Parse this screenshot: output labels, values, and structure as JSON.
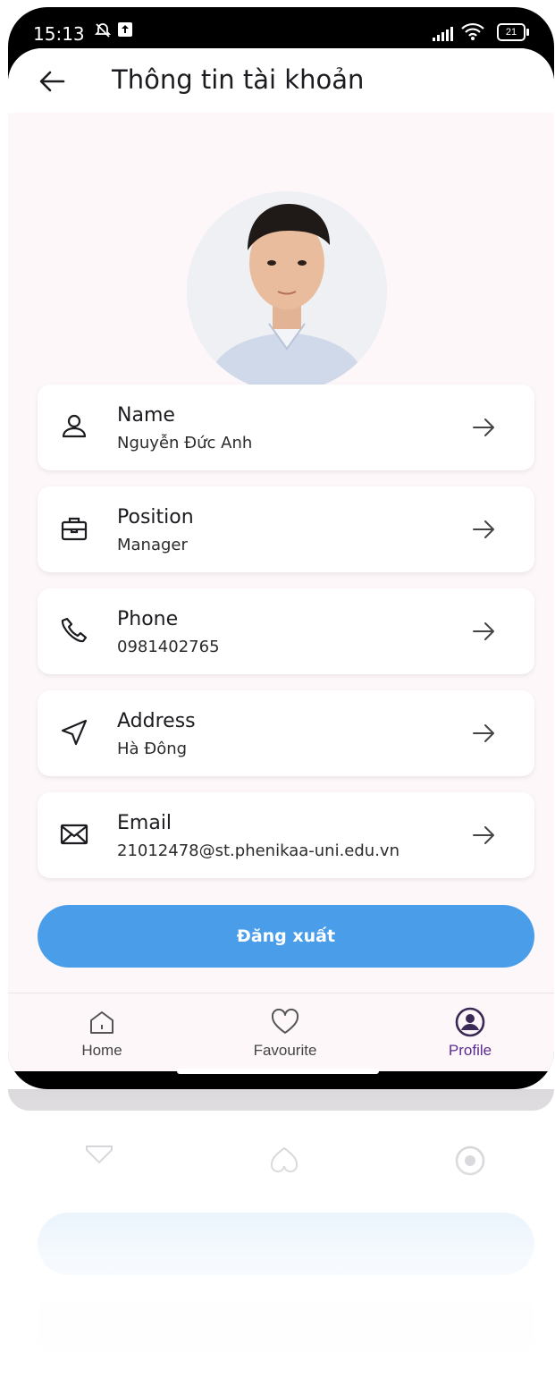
{
  "status_bar": {
    "time": "15:13",
    "battery": "21"
  },
  "app_bar": {
    "title": "Thông tin tài khoản"
  },
  "profile_items": [
    {
      "label": "Name",
      "value": "Nguyễn Đức Anh",
      "icon": "person-icon"
    },
    {
      "label": "Position",
      "value": "Manager",
      "icon": "briefcase-icon"
    },
    {
      "label": "Phone",
      "value": "0981402765",
      "icon": "phone-icon"
    },
    {
      "label": "Address",
      "value": "Hà Đông",
      "icon": "location-arrow-icon"
    },
    {
      "label": "Email",
      "value": "21012478@st.phenikaa-uni.edu.vn",
      "icon": "mail-icon"
    }
  ],
  "logout_label": "Đăng xuất",
  "bottom_nav": [
    {
      "label": "Home",
      "icon": "home-icon",
      "active": false
    },
    {
      "label": "Favourite",
      "icon": "heart-icon",
      "active": false
    },
    {
      "label": "Profile",
      "icon": "profile-icon",
      "active": true
    }
  ],
  "colors": {
    "primary": "#4a9ee9",
    "active_nav": "#5c2d8e",
    "background": "#fdf7fa"
  }
}
